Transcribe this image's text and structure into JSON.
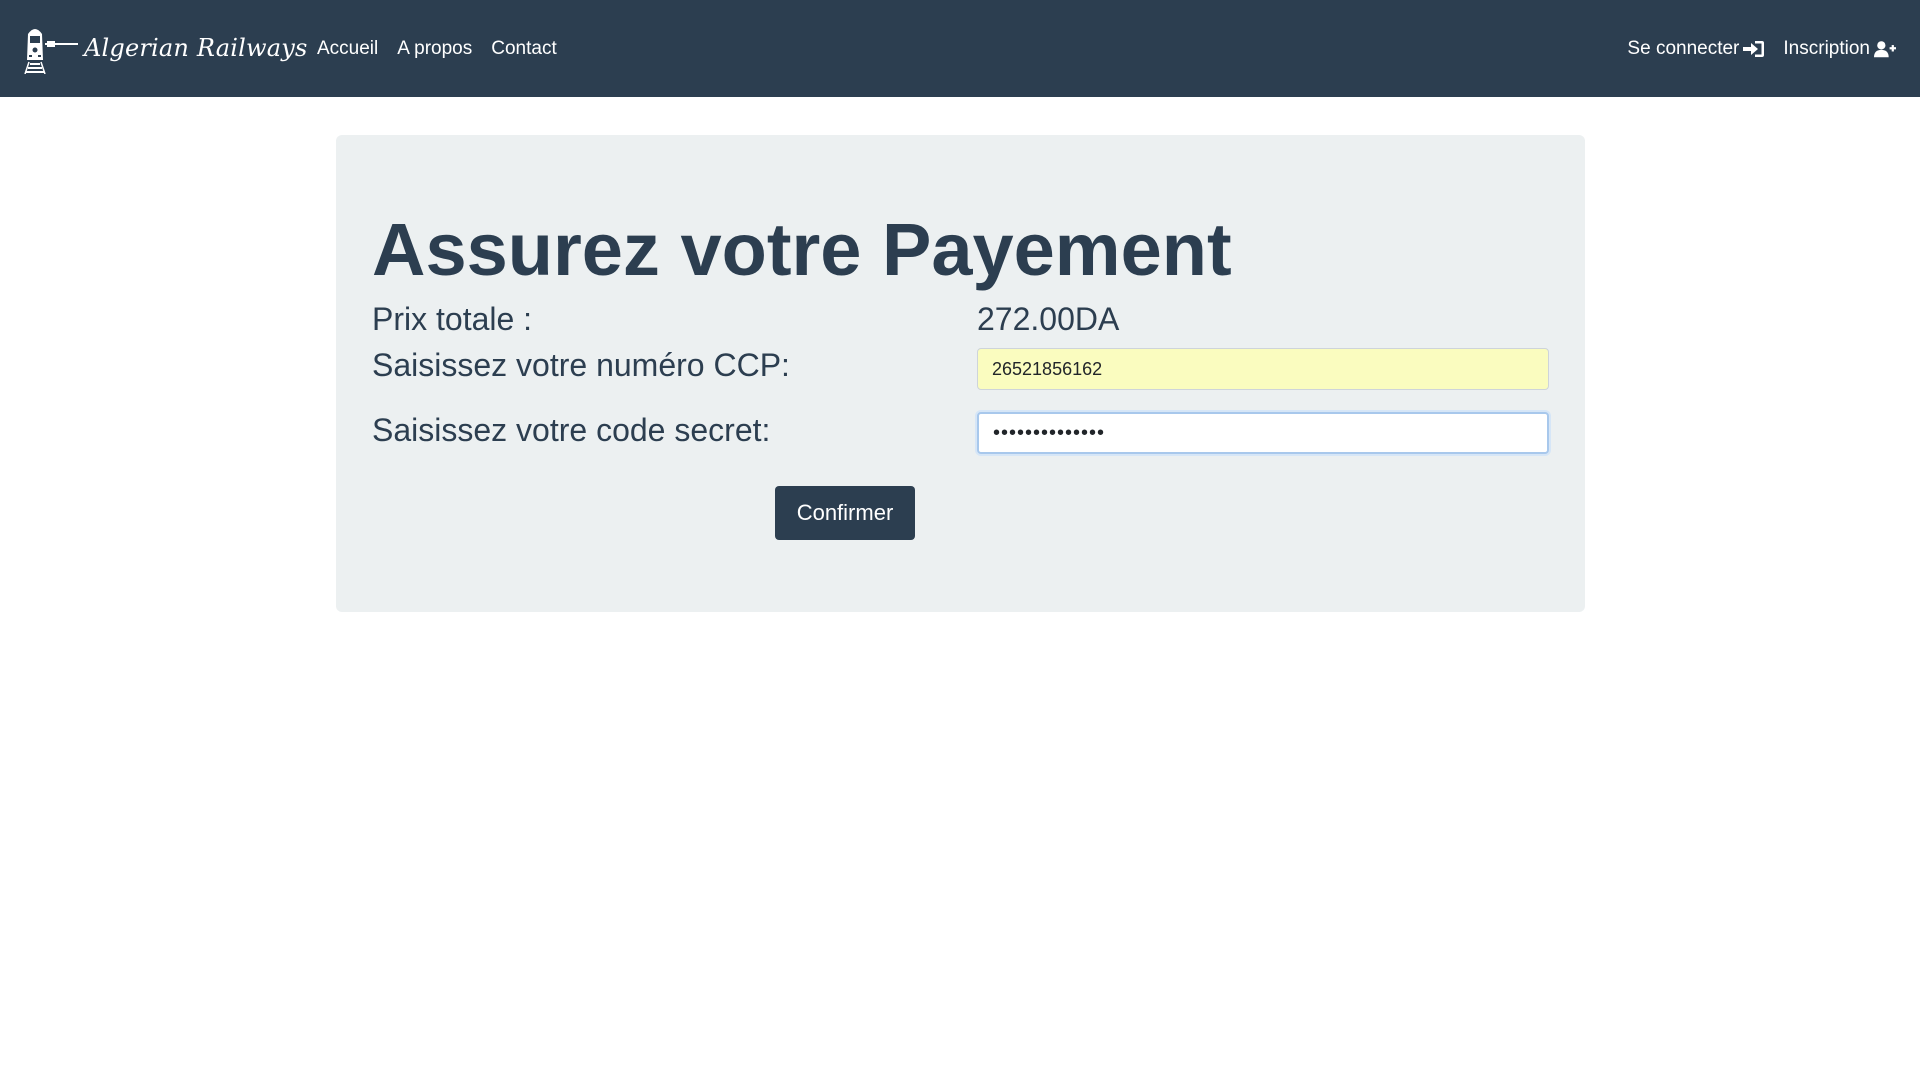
{
  "navbar": {
    "brand": "Algerian Railways",
    "links": [
      "Accueil",
      "A propos",
      "Contact"
    ],
    "login_label": "Se connecter",
    "signup_label": "Inscription",
    "background_color": "#2c3e50"
  },
  "payment": {
    "title": "Assurez votre Payement",
    "price_label": "Prix totale :",
    "price_value": "272.00DA",
    "ccp_label": "Saisissez votre numéro CCP:",
    "ccp_value": "26521856162",
    "secret_label": "Saisissez votre code secret:",
    "secret_value": "••••••••••••••",
    "confirm_label": "Confirmer"
  },
  "icons": {
    "brand": "train-icon",
    "login": "sign-in-icon",
    "signup": "user-plus-icon"
  },
  "colors": {
    "primary": "#2c3e50",
    "panel": "#ecf0f1",
    "autofill": "#fafcbf"
  }
}
